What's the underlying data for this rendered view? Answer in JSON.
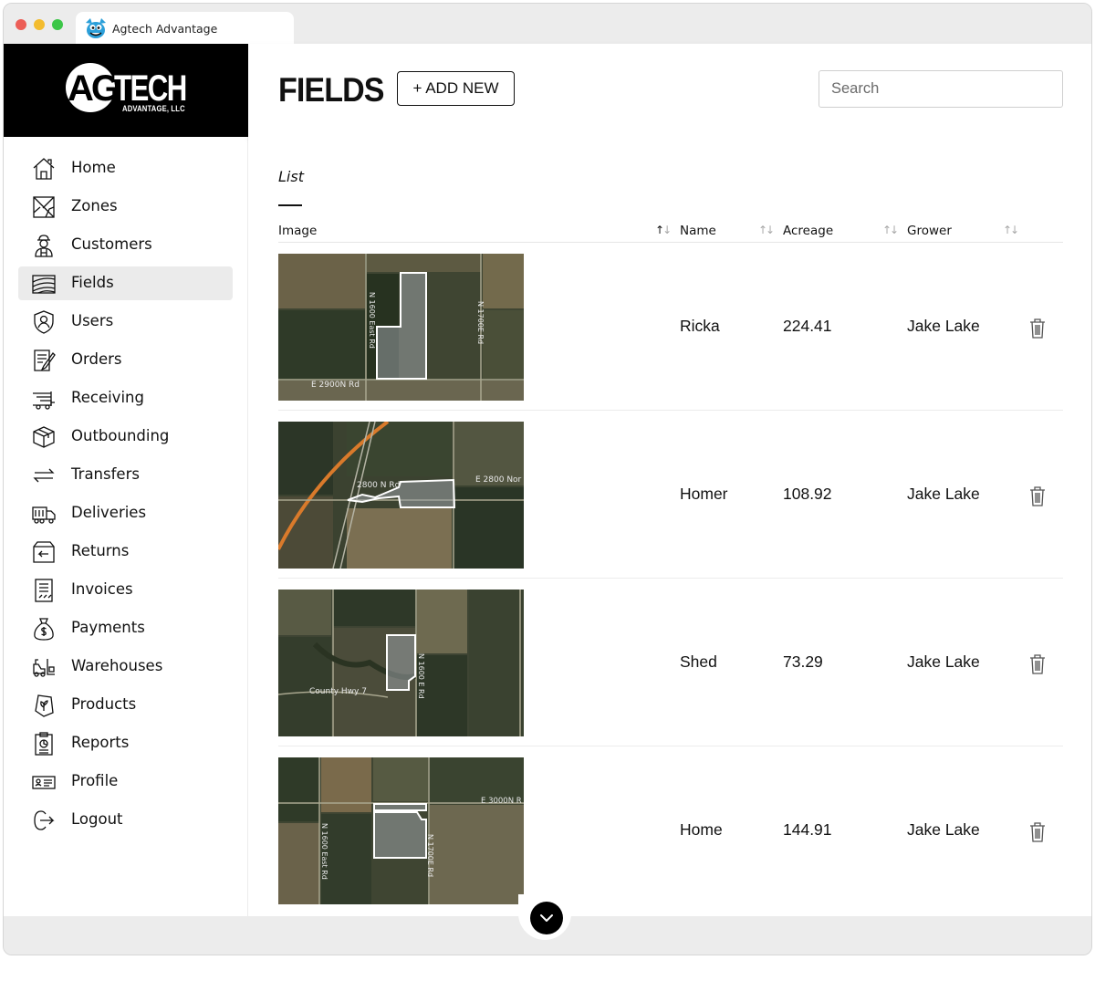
{
  "browser": {
    "tab_title": "Agtech Advantage"
  },
  "brand": {
    "logo_ag": "AG",
    "logo_tech": "TECH",
    "logo_sub": "ADVANTAGE, LLC"
  },
  "sidebar": {
    "items": [
      {
        "label": "Home",
        "icon": "home-icon",
        "active": false
      },
      {
        "label": "Zones",
        "icon": "zones-icon",
        "active": false
      },
      {
        "label": "Customers",
        "icon": "farmer-icon",
        "active": false
      },
      {
        "label": "Fields",
        "icon": "fields-icon",
        "active": true
      },
      {
        "label": "Users",
        "icon": "user-shield-icon",
        "active": false
      },
      {
        "label": "Orders",
        "icon": "orders-icon",
        "active": false
      },
      {
        "label": "Receiving",
        "icon": "truck-receiving-icon",
        "active": false
      },
      {
        "label": "Outbounding",
        "icon": "box-icon",
        "active": false
      },
      {
        "label": "Transfers",
        "icon": "transfer-arrows-icon",
        "active": false
      },
      {
        "label": "Deliveries",
        "icon": "delivery-truck-icon",
        "active": false
      },
      {
        "label": "Returns",
        "icon": "returns-icon",
        "active": false
      },
      {
        "label": "Invoices",
        "icon": "invoice-icon",
        "active": false
      },
      {
        "label": "Payments",
        "icon": "money-bag-icon",
        "active": false
      },
      {
        "label": "Warehouses",
        "icon": "forklift-icon",
        "active": false
      },
      {
        "label": "Products",
        "icon": "product-seed-icon",
        "active": false
      },
      {
        "label": "Reports",
        "icon": "clipboard-report-icon",
        "active": false
      },
      {
        "label": "Profile",
        "icon": "id-card-icon",
        "active": false
      },
      {
        "label": "Logout",
        "icon": "logout-icon",
        "active": false
      }
    ]
  },
  "header": {
    "title": "FIELDS",
    "add_button": "+ ADD NEW",
    "search_placeholder": "Search"
  },
  "list": {
    "section_label": "List",
    "columns": {
      "image": "Image",
      "name": "Name",
      "acreage": "Acreage",
      "grower": "Grower"
    },
    "rows": [
      {
        "name": "Ricka",
        "acreage": "224.41",
        "grower": "Jake Lake",
        "map_labels": [
          "N 1600 East Rd",
          "N 1700E Rd",
          "E 2900N Rd"
        ]
      },
      {
        "name": "Homer",
        "acreage": "108.92",
        "grower": "Jake Lake",
        "map_labels": [
          "2800 N Rd",
          "E 2800 Nor"
        ]
      },
      {
        "name": "Shed",
        "acreage": "73.29",
        "grower": "Jake Lake",
        "map_labels": [
          "County Hwy 7",
          "N 1600 E Rd"
        ]
      },
      {
        "name": "Home",
        "acreage": "144.91",
        "grower": "Jake Lake",
        "map_labels": [
          "E 3000N R",
          "N 1600 East Rd",
          "N 1700E Rd"
        ]
      }
    ]
  },
  "colors": {
    "sidebar_active": "#ebebeb",
    "logo_bg": "#000000",
    "field_outline": "#ffffff",
    "road_highlight": "#d97a2b"
  }
}
